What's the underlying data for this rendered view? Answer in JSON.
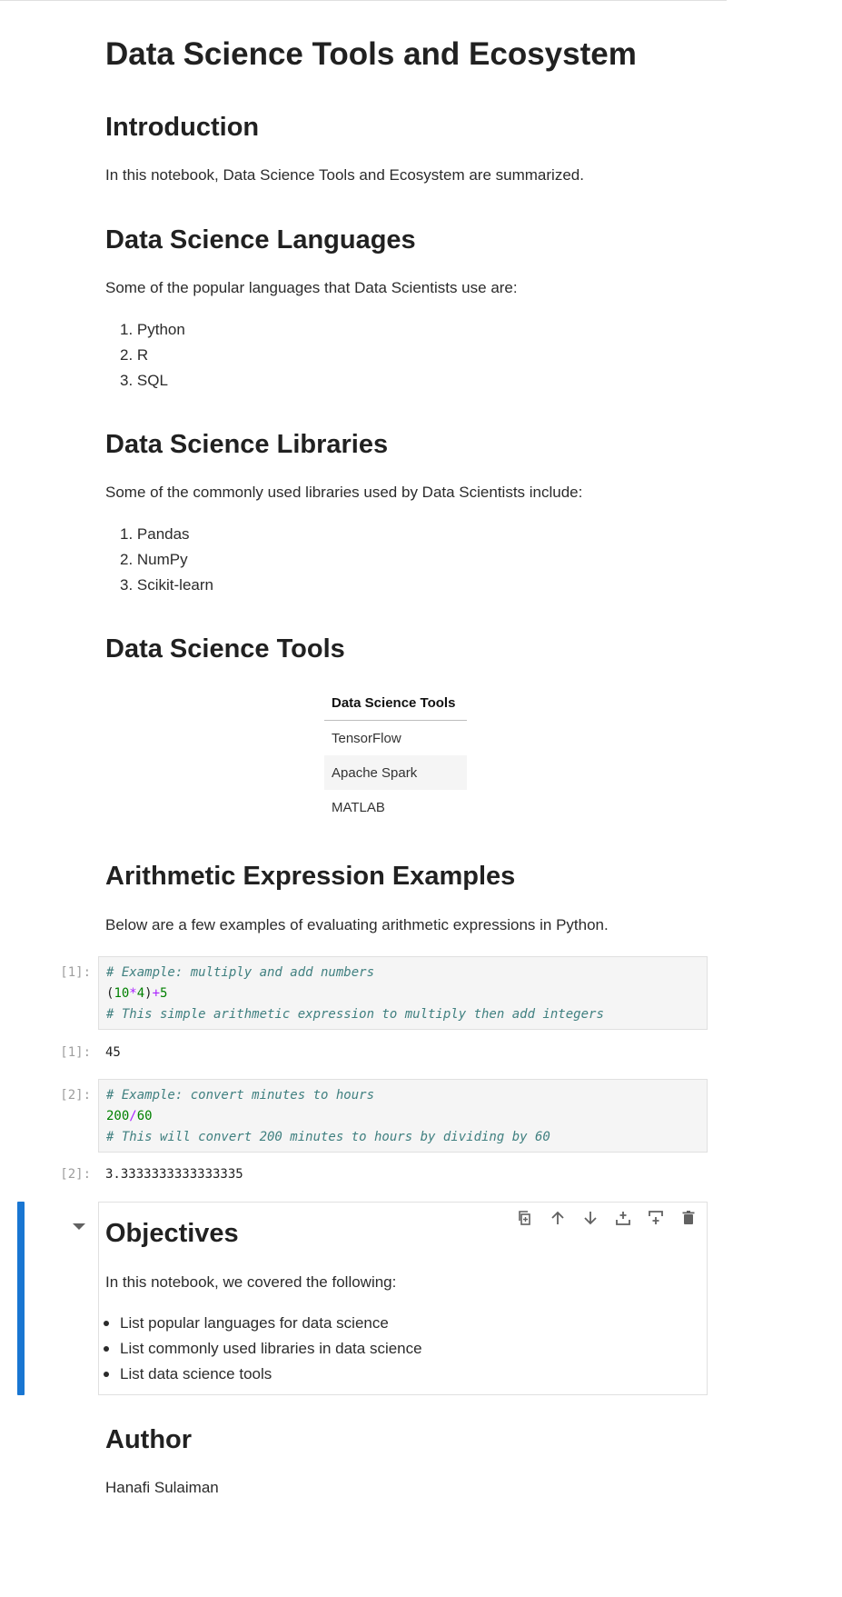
{
  "notebook": {
    "title": "Data Science Tools and Ecosystem",
    "intro": {
      "heading": "Introduction",
      "text": "In this notebook, Data Science Tools and Ecosystem are summarized."
    },
    "languages": {
      "heading": "Data Science Languages",
      "text": "Some of the popular languages that Data Scientists use are:",
      "items": [
        "1. Python",
        "2. R",
        "3. SQL"
      ]
    },
    "libraries": {
      "heading": "Data Science Libraries",
      "text": "Some of the commonly used libraries used by Data Scientists include:",
      "items": [
        "1. Pandas",
        "2. NumPy",
        "3. Scikit-learn"
      ]
    },
    "tools": {
      "heading": "Data Science Tools",
      "table_header": "Data Science Tools",
      "rows": [
        "TensorFlow",
        "Apache Spark",
        "MATLAB"
      ]
    },
    "arithmetic": {
      "heading": "Arithmetic Expression Examples",
      "text": "Below are a few examples of evaluating arithmetic expressions in Python."
    },
    "cells": [
      {
        "prompt": "[1]:",
        "comment1": "# Example: multiply and add numbers",
        "code": {
          "p1": "(",
          "n1": "10",
          "o1": "*",
          "n2": "4",
          "p2": ")",
          "o2": "+",
          "n3": "5"
        },
        "comment2": "# This simple arithmetic expression to multiply then add integers",
        "out_prompt": "[1]:",
        "output": "45"
      },
      {
        "prompt": "[2]:",
        "comment1": "# Example: convert minutes to hours",
        "code": {
          "n1": "200",
          "o1": "/",
          "n2": "60"
        },
        "comment2": "# This will convert 200 minutes to hours by dividing by 60",
        "out_prompt": "[2]:",
        "output": "3.3333333333333335"
      }
    ],
    "objectives": {
      "heading": "Objectives",
      "text": "In this notebook, we covered the following:",
      "items": [
        "List popular languages for data science",
        "List commonly used libraries in data science",
        "List data science tools"
      ]
    },
    "author": {
      "heading": "Author",
      "name": "Hanafi Sulaiman"
    }
  },
  "toolbar": {
    "icons": [
      "duplicate-icon",
      "move-up-icon",
      "move-down-icon",
      "insert-above-icon",
      "insert-below-icon",
      "delete-icon"
    ]
  },
  "colors": {
    "active_bar": "#1976d2",
    "code_bg": "#f5f5f5",
    "comment": "#408080",
    "number": "#008000",
    "operator": "#aa22ff"
  }
}
